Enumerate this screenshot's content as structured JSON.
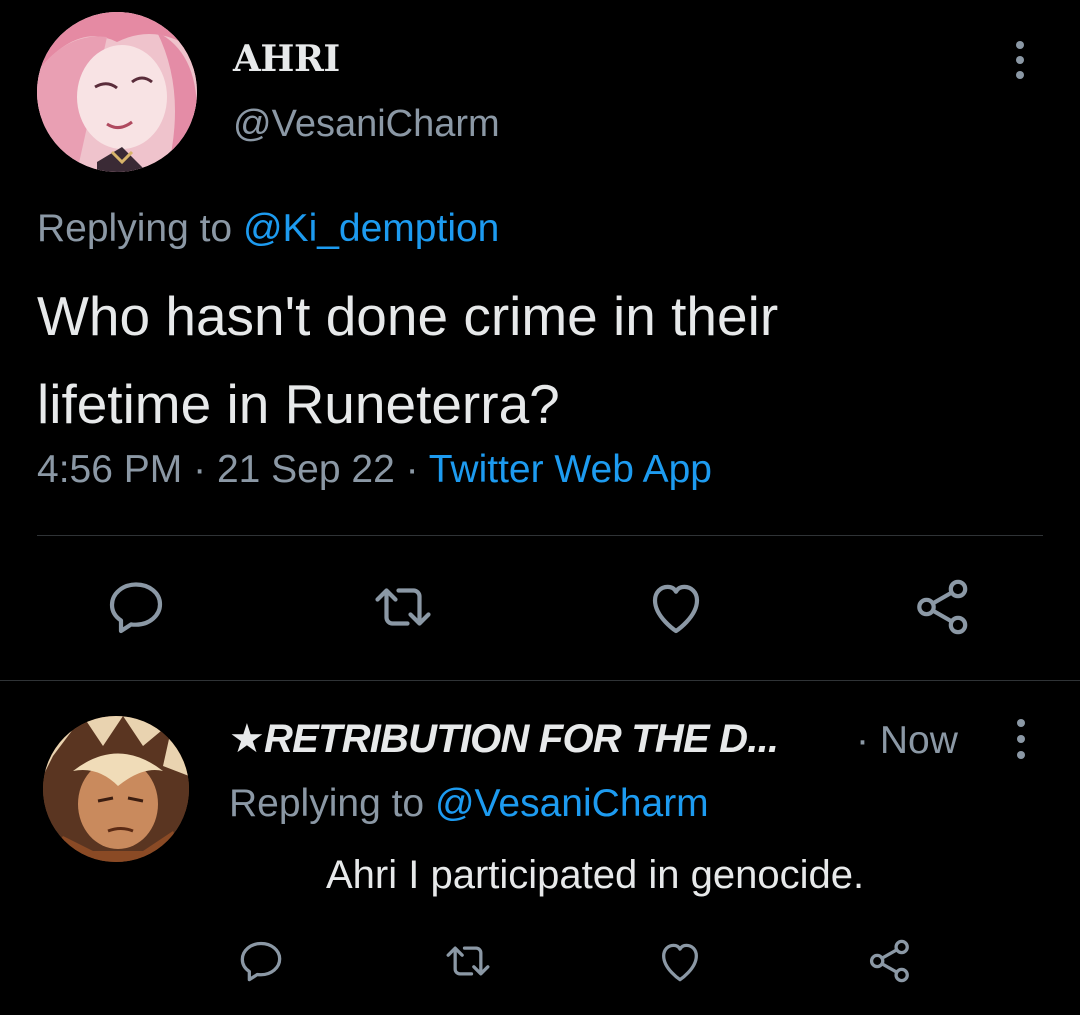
{
  "main_tweet": {
    "display_name": "AHRI",
    "handle": "@VesaniCharm",
    "replying_prefix": "Replying to",
    "replying_to": "@Ki_demption",
    "text_line1": "Who hasn't done crime in their",
    "text_line2": "lifetime in Runeterra?",
    "time": "4:56 PM",
    "date": "21 Sep 22",
    "source": "Twitter Web App",
    "separator": "·"
  },
  "reply_tweet": {
    "display_name": "★RETRIBUTION FOR THE D...",
    "separator": "·",
    "time": "Now",
    "replying_prefix": "Replying to",
    "replying_to": "@VesaniCharm",
    "text": "Ahri I participated in genocide."
  },
  "icons": {
    "reply": "reply-icon",
    "retweet": "retweet-icon",
    "like": "heart-icon",
    "share": "share-icon",
    "more": "more-vertical-icon"
  },
  "colors": {
    "background": "#000000",
    "text_primary": "#e7e9ea",
    "text_secondary": "#8b98a5",
    "accent": "#1d9bf0",
    "divider": "#2f3336"
  }
}
